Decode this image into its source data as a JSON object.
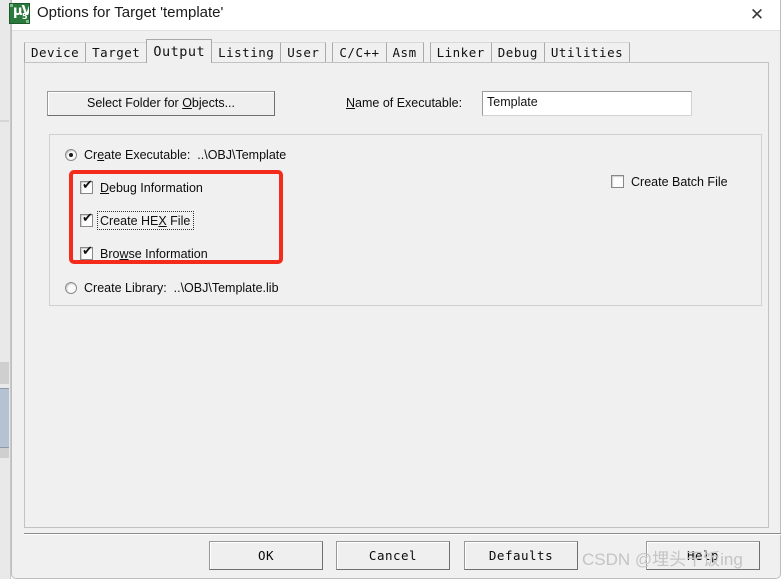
{
  "window": {
    "title": "Options for Target 'template'",
    "icon": "uvision-icon",
    "close_label": "✕"
  },
  "tabs": [
    {
      "label": "Device",
      "active": false
    },
    {
      "label": "Target",
      "active": false
    },
    {
      "label": "Output",
      "active": true
    },
    {
      "label": "Listing",
      "active": false
    },
    {
      "label": "User",
      "active": false
    },
    {
      "label": "C/C++",
      "active": false
    },
    {
      "label": "Asm",
      "active": false
    },
    {
      "label": "Linker",
      "active": false
    },
    {
      "label": "Debug",
      "active": false
    },
    {
      "label": "Utilities",
      "active": false
    }
  ],
  "output_tab": {
    "select_folder_button": "Select Folder for Objects...",
    "executable_name_label": "Name of Executable:",
    "executable_name_value": "Template",
    "create_executable": {
      "label": "Create Executable:",
      "path": "..\\OBJ\\Template",
      "selected": true
    },
    "create_library": {
      "label": "Create Library:",
      "path": "..\\OBJ\\Template.lib",
      "selected": false
    },
    "checkboxes": [
      {
        "label": "Debug Information",
        "checked": true,
        "mark": "✔",
        "focused": false
      },
      {
        "label": "Create HEX File",
        "checked": true,
        "mark": "✔",
        "focused": true
      },
      {
        "label": "Browse Information",
        "checked": true,
        "mark": "✔",
        "focused": false
      },
      {
        "label": "Create Batch File",
        "checked": false,
        "mark": "",
        "focused": false
      }
    ]
  },
  "annotation": {
    "color": "#f42a1a",
    "shape": "rounded-rectangle",
    "targets": [
      "Debug Information",
      "Create HEX File",
      "Browse Information"
    ]
  },
  "footer": {
    "ok": "OK",
    "cancel": "Cancel",
    "defaults": "Defaults",
    "help": "Help"
  },
  "watermark": {
    "prefix": "CSDN @",
    "handle": "埋头干饭",
    "suffix": "ing"
  }
}
